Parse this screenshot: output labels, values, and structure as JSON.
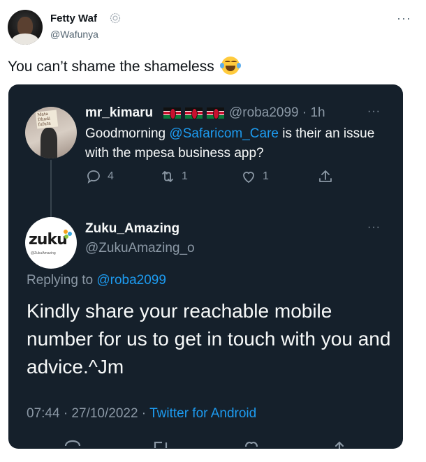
{
  "outer": {
    "name": "Fetty Waf",
    "handle": "@Wafunya",
    "more": "···",
    "text": "You can’t shame the shameless",
    "emoji_icon": "face-with-tears-of-joy-icon"
  },
  "quoted": {
    "name": "mr_kimaru",
    "flags": [
      "kenya-flag-icon",
      "kenya-flag-icon",
      "kenya-flag-icon"
    ],
    "handle_time": "@roba2099 · 1h",
    "more": "···",
    "text_before": "Goodmorning ",
    "mention": "@Safaricom_Care",
    "text_after": " is their an issue with the mpesa business app?",
    "avatar_sign": "Mata Dhadi fufuta",
    "actions": {
      "reply_count": "4",
      "retweet_count": "1",
      "like_count": "1"
    }
  },
  "reply": {
    "name": "Zuku_Amazing",
    "handle": "@ZukuAmazing_o",
    "more": "···",
    "avatar_logo": "zuku",
    "avatar_tag": "@ZukuAmazing",
    "replying_prefix": "Replying to ",
    "replying_to": "@roba2099",
    "text": "Kindly share your reachable mobile number for us to get in touch with you and advice.^Jm",
    "timestamp": "07:44 · 27/10/2022 · ",
    "source": "Twitter for Android"
  },
  "colors": {
    "card_bg": "#15202b",
    "accent": "#1d9bf0",
    "muted": "#8b98a5"
  }
}
